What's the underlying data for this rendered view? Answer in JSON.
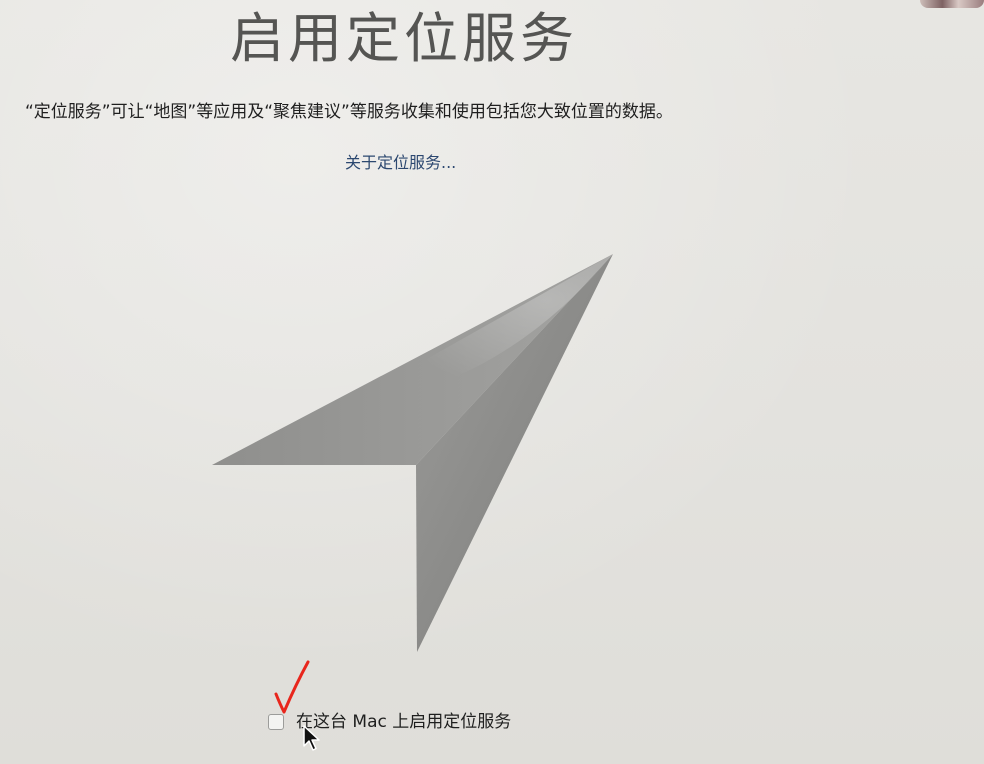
{
  "page": {
    "title": "启用定位服务",
    "description": "“定位服务”可让“地图”等应用及“聚焦建议”等服务收集和使用包括您大致位置的数据。",
    "about_link": "关于定位服务...",
    "checkbox_label": "在这台 Mac 上启用定位服务",
    "checkbox_checked": false
  },
  "icons": {
    "hero": "location-arrow-icon",
    "annotation": "red-check-mark-icon",
    "cursor": "mouse-pointer-icon"
  },
  "colors": {
    "background": "#e6e5e1",
    "title": "#555553",
    "link": "#2c4870",
    "annotation": "#e8261c"
  }
}
